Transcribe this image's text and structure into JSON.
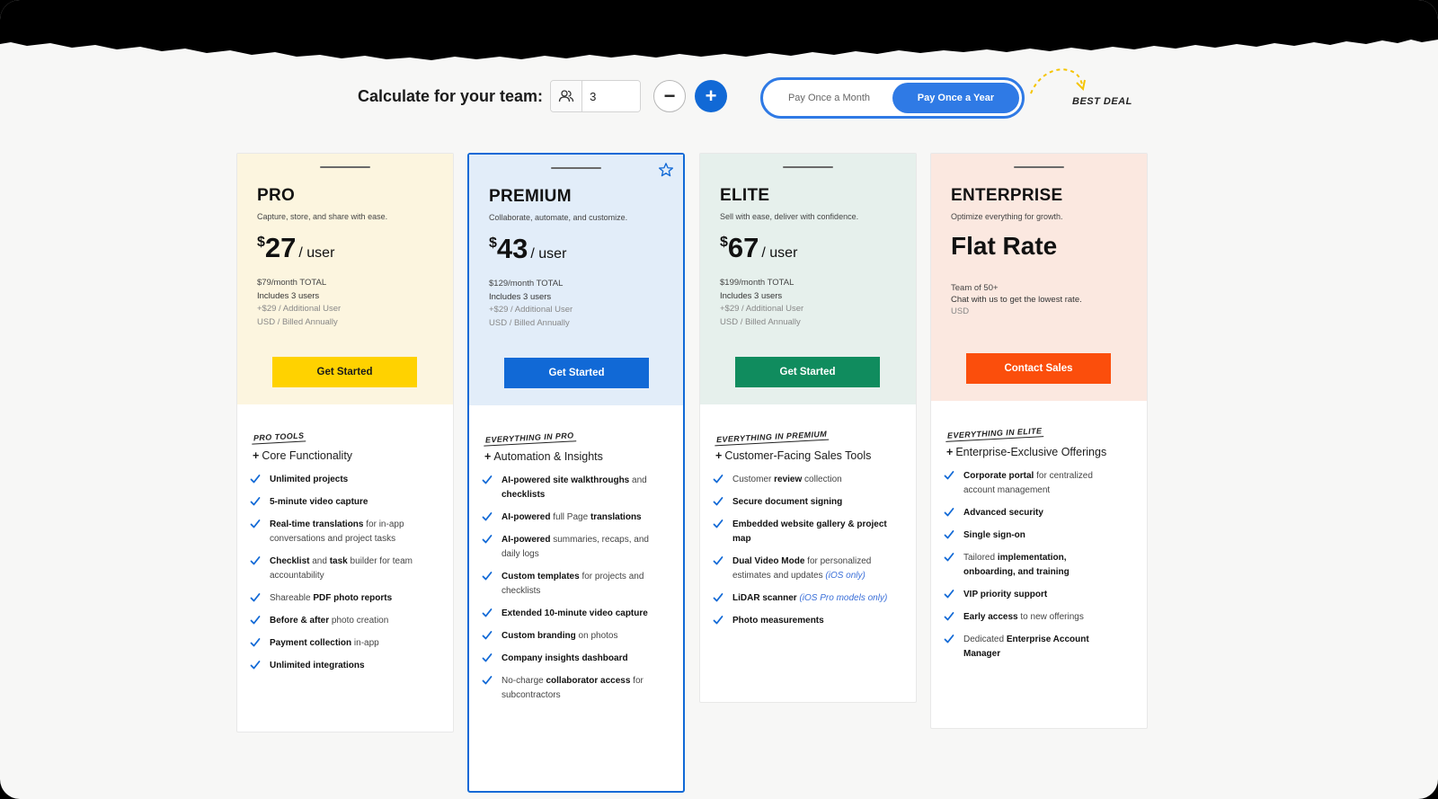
{
  "calculator": {
    "label": "Calculate for your team:",
    "team_size": "3",
    "minus": "−",
    "plus": "+"
  },
  "billing": {
    "monthly": "Pay Once a Month",
    "yearly": "Pay Once a Year",
    "selected": "yearly",
    "best_deal": "BEST DEAL"
  },
  "colors": {
    "accent_blue": "#1169d6",
    "toggle_blue": "#2f7ae5",
    "pro_bg": "#fcf5df",
    "premium_bg": "#e2edf9",
    "elite_bg": "#e6f0ec",
    "enterprise_bg": "#fbe8e0",
    "pro_button": "#ffd200",
    "premium_button": "#1169d6",
    "elite_button": "#108c5e",
    "enterprise_button": "#fb4e0c",
    "check": "#1169d6"
  },
  "plans": [
    {
      "name": "PRO",
      "tagline": "Capture, store, and share with ease.",
      "currency": "$",
      "price": "27",
      "per": "/ user",
      "total": "$79/month TOTAL",
      "includes": "Includes 3 users",
      "additional": "+$29 / Additional User",
      "billing_note": "USD / Billed Annually",
      "cta": "Get Started",
      "tools_label": "PRO TOOLS",
      "section": "Core Functionality",
      "features": [
        "<b>Unlimited projects</b>",
        "<b>5-minute video capture</b>",
        "<b>Real-time translations</b> for in-app conversations and project tasks",
        "<b>Checklist</b> and <b>task</b> builder for team accountability",
        "Shareable <b>PDF photo reports</b>",
        "<b>Before &amp; after</b> photo creation",
        "<b>Payment collection</b> in-app",
        "<b>Unlimited integrations</b>"
      ]
    },
    {
      "name": "PREMIUM",
      "tagline": "Collaborate, automate, and customize.",
      "currency": "$",
      "price": "43",
      "per": "/ user",
      "total": "$129/month TOTAL",
      "includes": "Includes 3 users",
      "additional": "+$29 / Additional User",
      "billing_note": "USD / Billed Annually",
      "cta": "Get Started",
      "tools_label": "EVERYTHING IN PRO",
      "section": "Automation & Insights",
      "features": [
        "<b>AI-powered site walkthroughs</b> and <b>checklists</b>",
        "<b>AI-powered</b> full Page <b>translations</b>",
        "<b>AI-powered</b> summaries, recaps, and daily logs",
        "<b>Custom templates</b> for projects and checklists",
        "<b>Extended 10-minute video capture</b>",
        "<b>Custom branding</b> on photos",
        "<b>Company insights dashboard</b>",
        "No-charge <b>collaborator access</b> for subcontractors"
      ]
    },
    {
      "name": "ELITE",
      "tagline": "Sell with ease, deliver with confidence.",
      "currency": "$",
      "price": "67",
      "per": "/ user",
      "total": "$199/month TOTAL",
      "includes": "Includes 3 users",
      "additional": "+$29 / Additional User",
      "billing_note": "USD / Billed Annually",
      "cta": "Get Started",
      "tools_label": "EVERYTHING IN PREMIUM",
      "section": "Customer-Facing Sales Tools",
      "features": [
        "Customer <b>review</b> collection",
        "<b>Secure document signing</b>",
        "<b>Embedded website gallery &amp; project map</b>",
        "<b>Dual Video Mode</b> for personalized estimates and updates <i>(iOS only)</i>",
        "<b>LiDAR scanner</b> <i>(iOS Pro models only)</i>",
        "<b>Photo measurements</b>"
      ]
    },
    {
      "name": "ENTERPRISE",
      "tagline": "Optimize everything for growth.",
      "flat": "Flat Rate",
      "team_note": "Team of 50+",
      "chat_note": "Chat with us to get the lowest rate.",
      "usd": "USD",
      "cta": "Contact Sales",
      "tools_label": "EVERYTHING IN ELITE",
      "section": "Enterprise-Exclusive Offerings",
      "features": [
        "<b>Corporate portal</b> for centralized account management",
        "<b>Advanced security</b>",
        "<b>Single sign-on</b>",
        "Tailored <b>implementation, onboarding, and training</b>",
        "<b>VIP priority support</b>",
        "<b>Early access</b> to new offerings",
        "Dedicated <b>Enterprise Account Manager</b>"
      ]
    }
  ]
}
